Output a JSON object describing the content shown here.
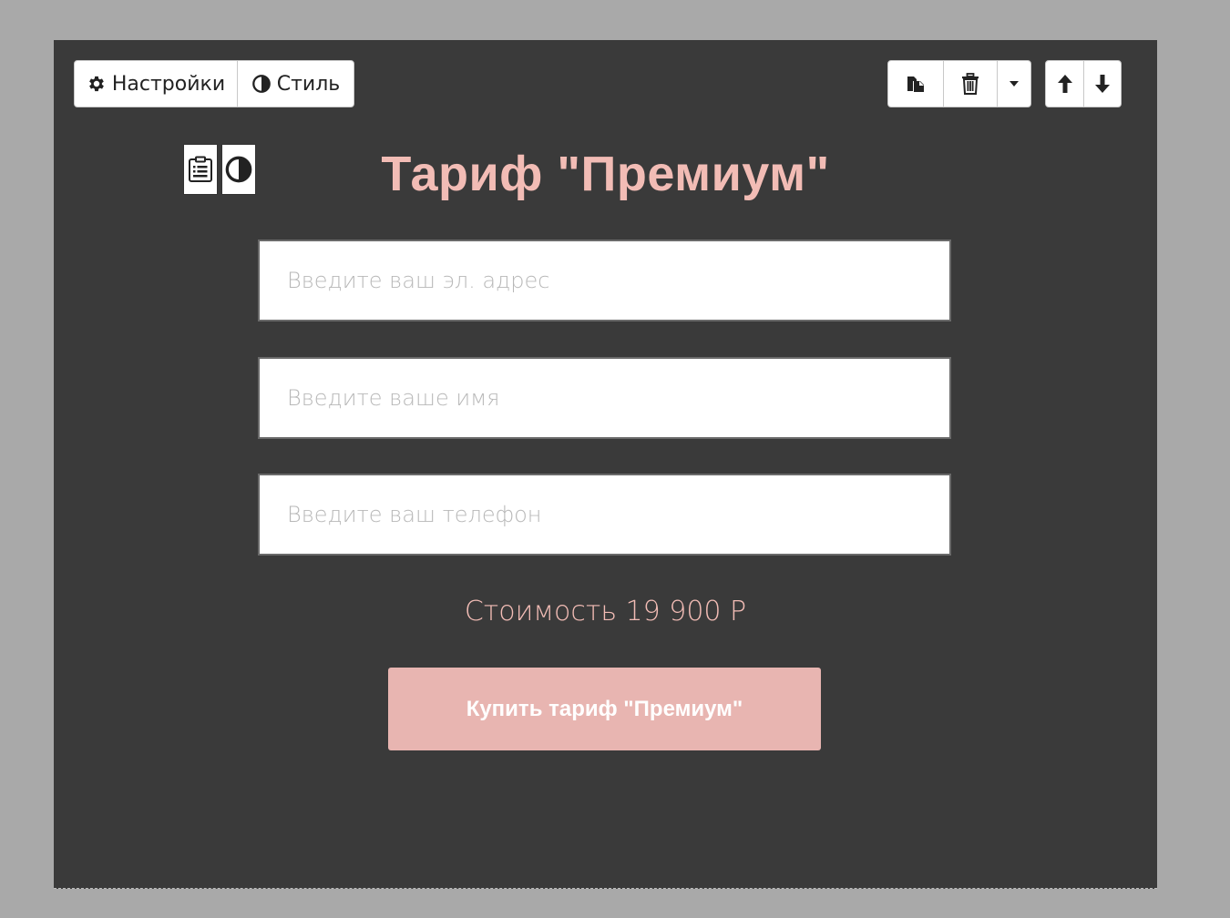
{
  "toolbar": {
    "settings_label": "Настройки",
    "settings_icon": "gear-icon",
    "style_label": "Стиль",
    "style_icon": "contrast-icon",
    "actions": [
      "copy-icon",
      "trash-icon",
      "caret-down-icon",
      "arrow-up-icon",
      "arrow-down-icon"
    ]
  },
  "block_tools": [
    "form-list-icon",
    "contrast-icon"
  ],
  "form": {
    "title": "Тариф \"Премиум\"",
    "email_placeholder": "Введите ваш эл. адрес",
    "name_placeholder": "Введите ваше имя",
    "phone_placeholder": "Введите ваш телефон",
    "price_text": "Стоимость 19 900 Р",
    "submit_label": "Купить тариф \"Премиум\""
  },
  "colors": {
    "background": "#a9a9a9",
    "panel": "#3a3a3a",
    "accent": "#f2bcb5",
    "button": "#e8b5b1"
  }
}
